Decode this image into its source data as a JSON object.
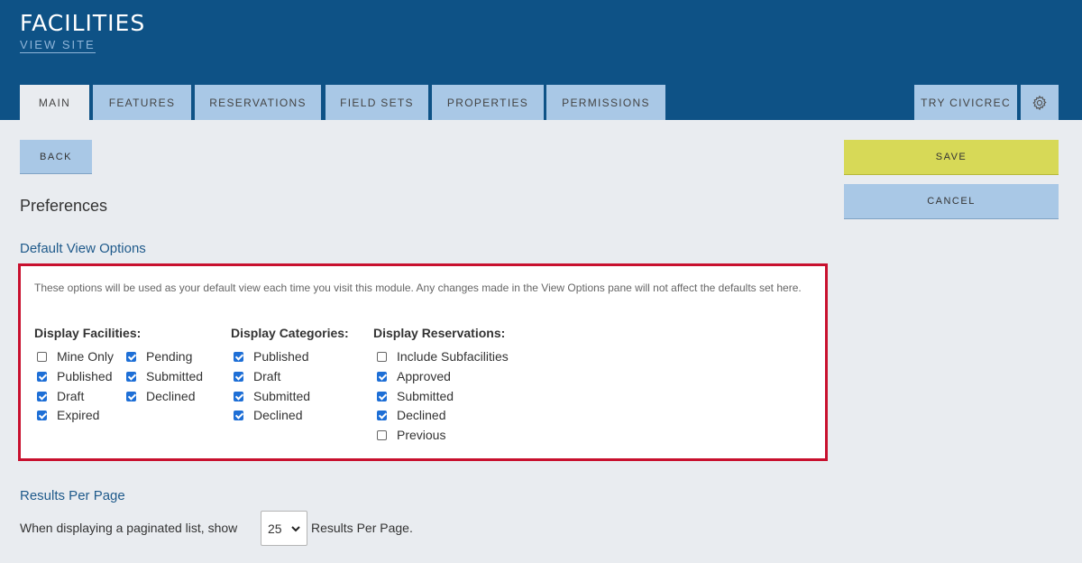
{
  "header": {
    "title": "FACILITIES",
    "view_site": "VIEW SITE",
    "tabs": [
      {
        "label": "MAIN",
        "active": true
      },
      {
        "label": "FEATURES"
      },
      {
        "label": "RESERVATIONS"
      },
      {
        "label": "FIELD SETS"
      },
      {
        "label": "PROPERTIES"
      },
      {
        "label": "PERMISSIONS"
      }
    ],
    "try_civicrec": "TRY CIVICREC",
    "settings_icon": "gear-icon"
  },
  "actions": {
    "back": "BACK",
    "save": "SAVE",
    "cancel": "CANCEL"
  },
  "preferences": {
    "title": "Preferences",
    "default_view_title": "Default View Options",
    "note": "These options will be used as your default view each time you visit this module. Any changes made in the View Options pane will not affect the defaults set here.",
    "display_facilities": {
      "title": "Display Facilities:",
      "options": [
        {
          "label": "Mine Only",
          "checked": false
        },
        {
          "label": "Published",
          "checked": true
        },
        {
          "label": "Draft",
          "checked": true
        },
        {
          "label": "Expired",
          "checked": true
        },
        {
          "label": "Pending",
          "checked": true
        },
        {
          "label": "Submitted",
          "checked": true
        },
        {
          "label": "Declined",
          "checked": true
        }
      ]
    },
    "display_categories": {
      "title": "Display Categories:",
      "options": [
        {
          "label": "Published",
          "checked": true
        },
        {
          "label": "Draft",
          "checked": true
        },
        {
          "label": "Submitted",
          "checked": true
        },
        {
          "label": "Declined",
          "checked": true
        }
      ]
    },
    "display_reservations": {
      "title": "Display Reservations:",
      "options": [
        {
          "label": "Include Subfacilities",
          "checked": false
        },
        {
          "label": "Approved",
          "checked": true
        },
        {
          "label": "Submitted",
          "checked": true
        },
        {
          "label": "Declined",
          "checked": true
        },
        {
          "label": "Previous",
          "checked": false
        }
      ]
    },
    "results_per_page": {
      "title": "Results Per Page",
      "prefix": "When displaying a paginated list, show",
      "value": "25",
      "suffix": "Results Per Page."
    }
  },
  "colors": {
    "header": "#0e5286",
    "tab": "#a9c8e6",
    "save": "#d7d957",
    "highlight_border": "#c8102e",
    "checkbox": "#1e6fd6"
  }
}
